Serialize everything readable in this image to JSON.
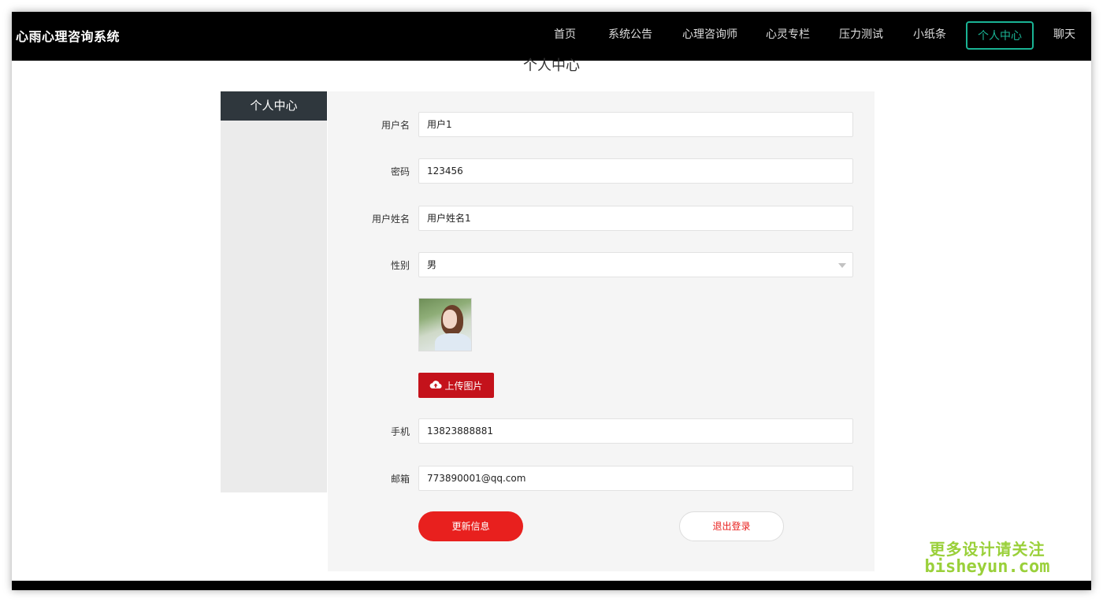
{
  "app": {
    "brand": "心雨心理咨询系统"
  },
  "nav": {
    "items": [
      {
        "label": "首页"
      },
      {
        "label": "系统公告"
      },
      {
        "label": "心理咨询师"
      },
      {
        "label": "心灵专栏"
      },
      {
        "label": "压力测试"
      },
      {
        "label": "小纸条"
      },
      {
        "label": "个人中心",
        "active": true
      },
      {
        "label": "聊天"
      }
    ],
    "active_color": "#1ab394"
  },
  "page": {
    "title": "个人中心"
  },
  "sidebar": {
    "title": "个人中心"
  },
  "form": {
    "username": {
      "label": "用户名",
      "value": "用户1"
    },
    "password": {
      "label": "密码",
      "value": "123456"
    },
    "fullname": {
      "label": "用户姓名",
      "value": "用户姓名1"
    },
    "gender": {
      "label": "性别",
      "value": "男"
    },
    "upload": {
      "label": "上传图片",
      "icon": "cloud-upload-icon"
    },
    "phone": {
      "label": "手机",
      "value": "13823888881"
    },
    "email": {
      "label": "邮箱",
      "value": "773890001@qq.com"
    },
    "update_button": "更新信息",
    "logout_button": "退出登录"
  },
  "watermark": {
    "line1": "更多设计请关注",
    "line2": "bisheyun.com"
  },
  "colors": {
    "primary_red": "#e8201e",
    "upload_red": "#c4121b",
    "sidebar_header": "#2f373d"
  }
}
